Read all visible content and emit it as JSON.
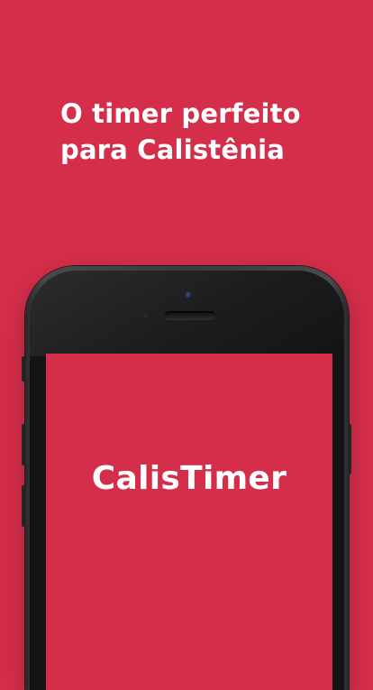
{
  "headline": {
    "line1": "O timer perfeito",
    "line2": "para Calistênia"
  },
  "device": {
    "screen_title": "CalisTimer"
  },
  "colors": {
    "brand_background": "#d52e4a",
    "device_frame": "#141416",
    "text": "#ffffff"
  }
}
